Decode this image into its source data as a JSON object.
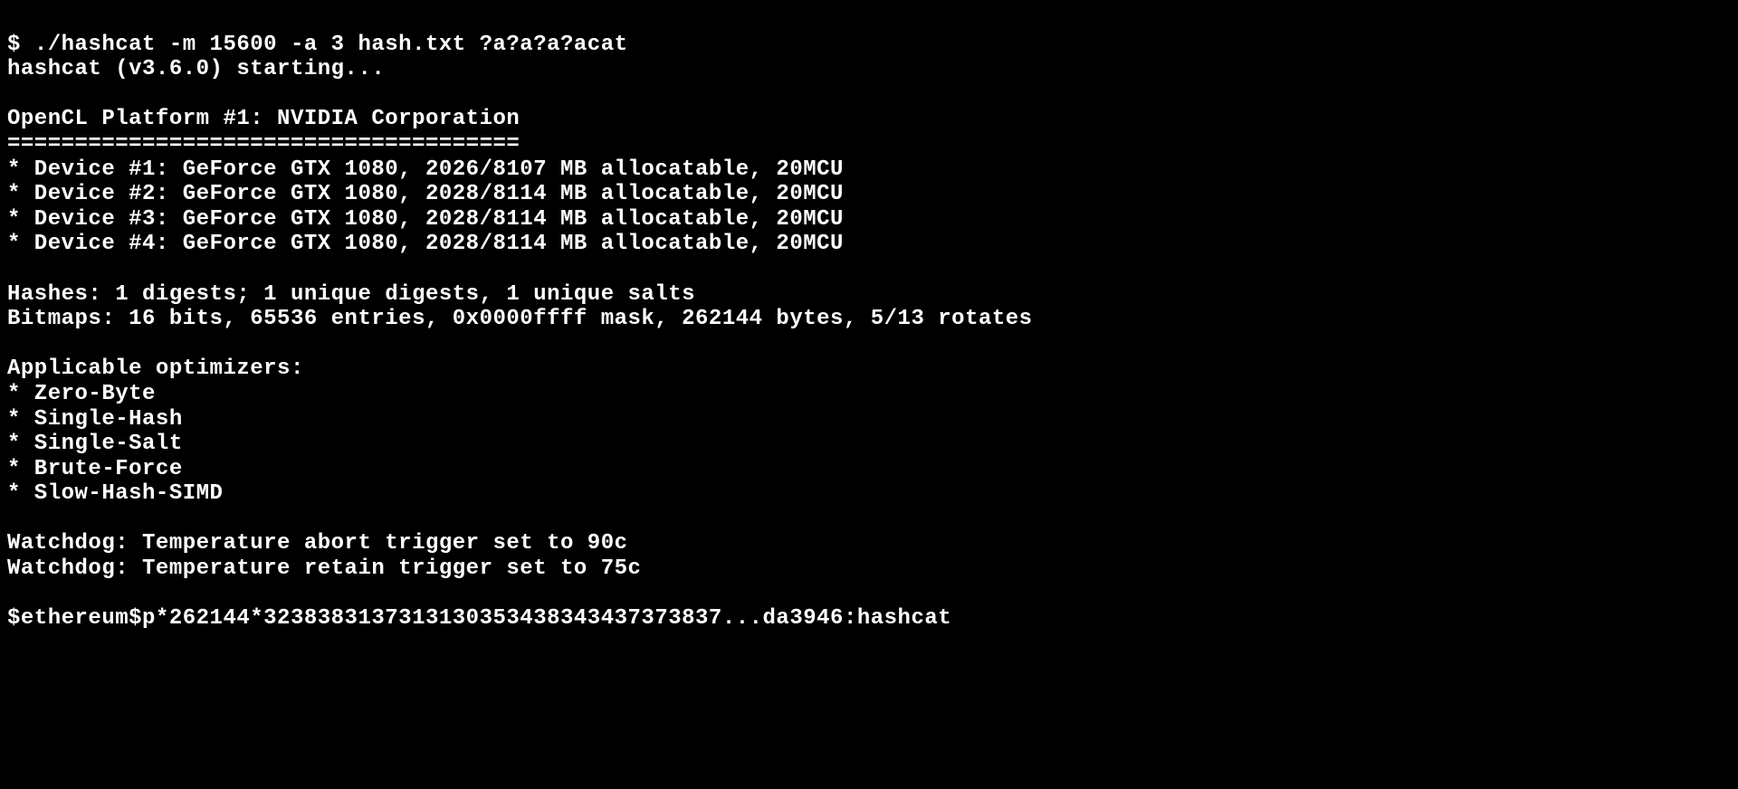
{
  "terminal": {
    "prompt": "$ ",
    "command": "./hashcat -m 15600 -a 3 hash.txt ?a?a?a?acat",
    "starting": "hashcat (v3.6.0) starting...",
    "blank": "",
    "platform_header": "OpenCL Platform #1: NVIDIA Corporation",
    "platform_divider": "======================================",
    "device1": "* Device #1: GeForce GTX 1080, 2026/8107 MB allocatable, 20MCU",
    "device2": "* Device #2: GeForce GTX 1080, 2028/8114 MB allocatable, 20MCU",
    "device3": "* Device #3: GeForce GTX 1080, 2028/8114 MB allocatable, 20MCU",
    "device4": "* Device #4: GeForce GTX 1080, 2028/8114 MB allocatable, 20MCU",
    "hashes": "Hashes: 1 digests; 1 unique digests, 1 unique salts",
    "bitmaps": "Bitmaps: 16 bits, 65536 entries, 0x0000ffff mask, 262144 bytes, 5/13 rotates",
    "optimizers_header": "Applicable optimizers:",
    "opt1": "* Zero-Byte",
    "opt2": "* Single-Hash",
    "opt3": "* Single-Salt",
    "opt4": "* Brute-Force",
    "opt5": "* Slow-Hash-SIMD",
    "watchdog1": "Watchdog: Temperature abort trigger set to 90c",
    "watchdog2": "Watchdog: Temperature retain trigger set to 75c",
    "result": "$ethereum$p*262144*3238383137313130353438343437373837...da3946:hashcat"
  }
}
